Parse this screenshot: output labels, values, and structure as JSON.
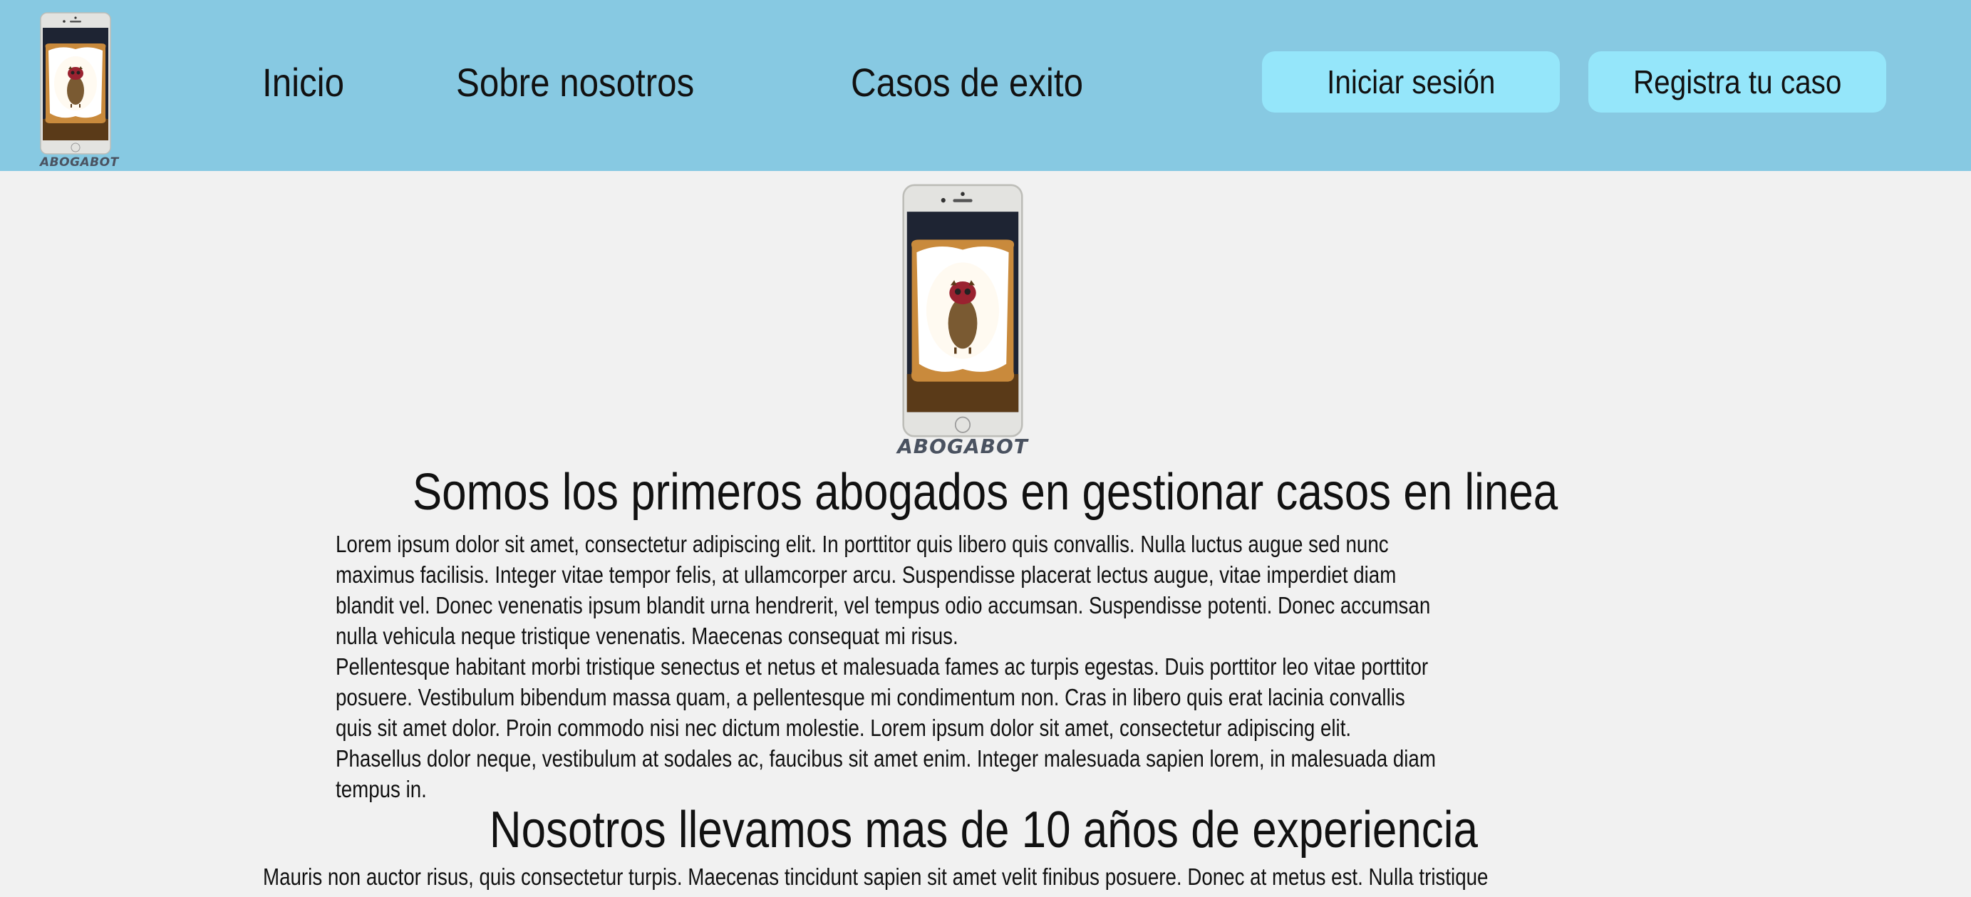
{
  "header": {
    "logo_caption": "ABOGABOT",
    "nav": [
      {
        "label": "Inicio"
      },
      {
        "label": "Sobre nosotros"
      },
      {
        "label": "Casos de exito"
      }
    ],
    "login_label": "Iniciar sesión",
    "register_label": "Registra tu caso",
    "colors": {
      "header_bg": "#87c9e2",
      "button_bg": "#95e6fa",
      "page_bg": "#f1f1f1"
    }
  },
  "hero": {
    "logo_caption": "ABOGABOT",
    "title": "Somos los primeros abogados en gestionar casos en linea",
    "paragraph_lines": [
      "Lorem ipsum dolor sit amet, consectetur adipiscing elit. In porttitor quis libero quis convallis. Nulla luctus augue sed nunc",
      "maximus facilisis. Integer vitae tempor felis, at ullamcorper arcu. Suspendisse placerat lectus augue, vitae imperdiet diam",
      "blandit vel. Donec venenatis ipsum blandit urna hendrerit, vel tempus odio accumsan. Suspendisse potenti. Donec accumsan",
      "nulla vehicula neque tristique venenatis. Maecenas consequat mi risus.",
      " Pellentesque habitant morbi tristique senectus et netus et malesuada fames ac turpis egestas. Duis porttitor leo vitae porttitor",
      "posuere. Vestibulum bibendum massa quam, a pellentesque mi condimentum non. Cras in libero quis erat lacinia convallis",
      "quis sit amet dolor. Proin commodo nisi nec dictum molestie. Lorem ipsum dolor sit amet, consectetur adipiscing elit.",
      "Phasellus dolor neque, vestibulum at sodales ac, faucibus sit amet enim. Integer malesuada sapien lorem, in malesuada diam",
      "tempus in."
    ]
  },
  "experience": {
    "title": "Nosotros llevamos mas de 10 años de experiencia",
    "paragraph_lines": [
      "Mauris non auctor risus, quis consectetur turpis. Maecenas tincidunt sapien sit amet velit finibus posuere. Donec at metus est. Nulla tristique"
    ]
  }
}
